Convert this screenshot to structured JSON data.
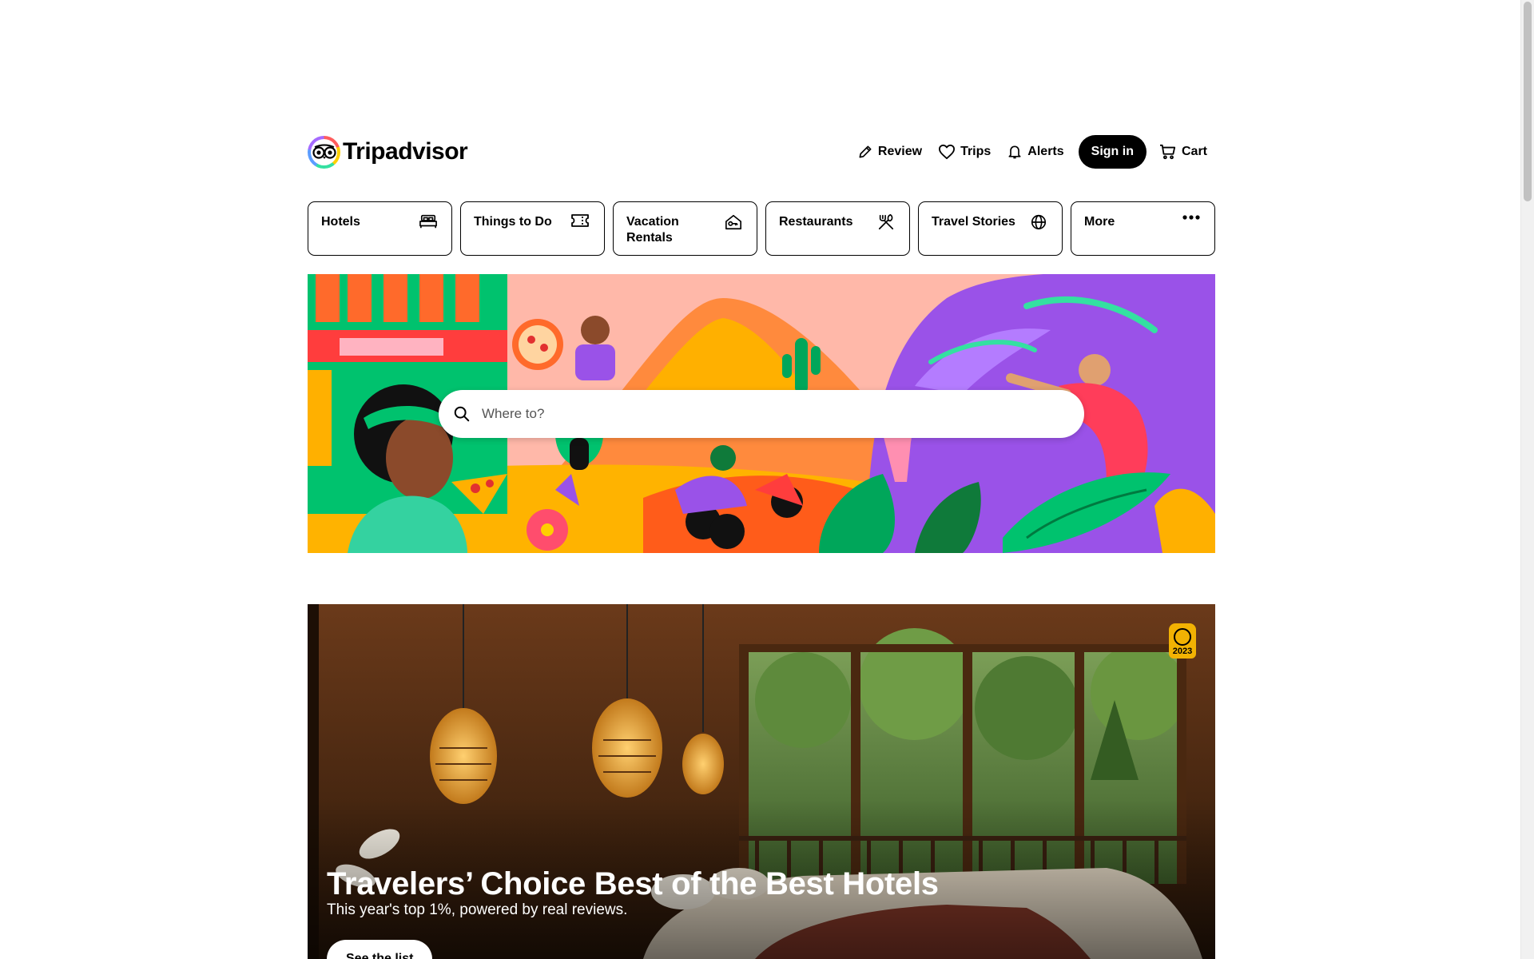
{
  "header": {
    "logo_text": "Tripadvisor",
    "nav": {
      "review": "Review",
      "trips": "Trips",
      "alerts": "Alerts",
      "sign_in": "Sign in",
      "cart": "Cart"
    }
  },
  "tabs": [
    {
      "label": "Hotels",
      "icon": "bed-icon"
    },
    {
      "label": "Things to Do",
      "icon": "ticket-icon"
    },
    {
      "label": "Vacation Rentals",
      "icon": "house-key-icon"
    },
    {
      "label": "Restaurants",
      "icon": "fork-knife-icon"
    },
    {
      "label": "Travel Stories",
      "icon": "globe-icon"
    },
    {
      "label": "More",
      "icon": "ellipsis-icon"
    }
  ],
  "search": {
    "placeholder": "Where to?"
  },
  "promo": {
    "title": "Travelers’ Choice Best of the Best Hotels",
    "subtitle": "This year's top 1%, powered by real reviews.",
    "button": "See the list",
    "badge_year": "2023"
  },
  "colors": {
    "primary": "#000000",
    "hero_pink": "#ffb8a9",
    "hero_orange": "#ff8a00",
    "hero_green": "#00c26e",
    "hero_purple": "#9a52e8",
    "badge_gold": "#f2b203"
  }
}
